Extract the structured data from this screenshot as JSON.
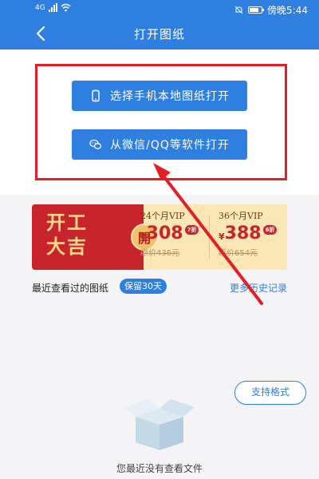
{
  "status_bar": {
    "network": "4G",
    "time": "傍晚5:44"
  },
  "nav": {
    "title": "打开图纸",
    "back_icon": "chevron-left-icon"
  },
  "open_options": {
    "local_label": "选择手机本地图纸打开",
    "wechat_label": "从微信/QQ等软件打开"
  },
  "banner": {
    "title_line1": "开工",
    "title_line2": "大吉",
    "badge": "開",
    "vip24": {
      "label": "24个月VIP",
      "currency": "¥",
      "price": "308",
      "discount": "7折",
      "original": "原价436元"
    },
    "vip36": {
      "label": "36个月VIP",
      "currency": "¥",
      "price": "388",
      "discount": "6折",
      "original": "原价654元"
    }
  },
  "recent": {
    "label": "最近查看过的图纸",
    "keep_badge": "保留30天",
    "history_link": "更多历史记录",
    "format_button": "支持格式",
    "empty_text": "您最近没有查看文件"
  },
  "colors": {
    "primary": "#2e7fe0",
    "highlight_frame": "#e21f24",
    "banner_red": "#c8242b"
  }
}
